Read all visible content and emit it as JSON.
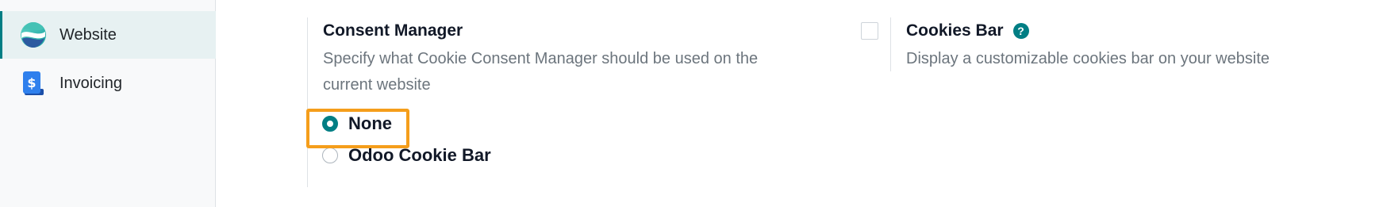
{
  "sidebar": {
    "items": [
      {
        "label": "Website",
        "icon": "website-app-icon",
        "active": true
      },
      {
        "label": "Invoicing",
        "icon": "invoicing-app-icon",
        "active": false
      }
    ]
  },
  "consent_manager": {
    "title": "Consent Manager",
    "description": "Specify what Cookie Consent Manager should be used on the current website",
    "options": [
      {
        "label": "None",
        "checked": true
      },
      {
        "label": "Odoo Cookie Bar",
        "checked": false
      }
    ]
  },
  "cookies_bar": {
    "title": "Cookies Bar",
    "description": "Display a customizable cookies bar on your website",
    "checked": false,
    "help_icon": "?"
  },
  "colors": {
    "accent": "#017e84",
    "highlight": "#f59e1b"
  }
}
